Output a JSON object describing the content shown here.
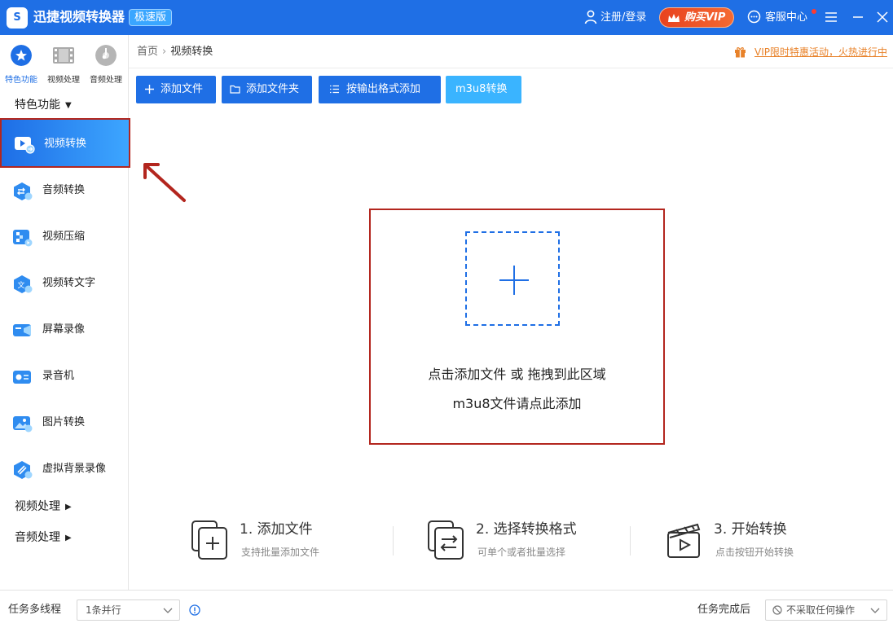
{
  "titlebar": {
    "logo_text": "S",
    "app_title": "迅捷视频转换器",
    "edition_badge": "极速版",
    "login_label": "注册/登录",
    "vip_label": "购买VIP",
    "service_label": "客服中心"
  },
  "sidebar": {
    "top_tabs": [
      {
        "label": "特色功能",
        "icon": "star-icon",
        "active": true
      },
      {
        "label": "视频处理",
        "icon": "film-icon",
        "active": false
      },
      {
        "label": "音频处理",
        "icon": "music-disc-icon",
        "active": false
      }
    ],
    "section_featured": "特色功能",
    "items": [
      {
        "label": "视频转换",
        "icon": "video-convert-icon",
        "active": true
      },
      {
        "label": "音频转换",
        "icon": "audio-convert-icon"
      },
      {
        "label": "视频压缩",
        "icon": "video-compress-icon"
      },
      {
        "label": "视频转文字",
        "icon": "video-to-text-icon"
      },
      {
        "label": "屏幕录像",
        "icon": "screen-record-icon"
      },
      {
        "label": "录音机",
        "icon": "recorder-icon"
      },
      {
        "label": "图片转换",
        "icon": "image-convert-icon"
      },
      {
        "label": "虚拟背景录像",
        "icon": "virtual-background-icon"
      }
    ],
    "section_video": "视频处理",
    "section_audio": "音频处理"
  },
  "breadcrumb": {
    "home": "首页",
    "separator": "›",
    "current": "视频转换"
  },
  "promo_text": "VIP限时特惠活动，火热进行中",
  "toolbar": {
    "add_file": "添加文件",
    "add_folder": "添加文件夹",
    "add_by_format": "按输出格式添加",
    "m3u8": "m3u8转换"
  },
  "drop_zone": {
    "line1": "点击添加文件 或 拖拽到此区域",
    "line2": "m3u8文件请点此添加"
  },
  "steps": [
    {
      "title": "1. 添加文件",
      "desc": "支持批量添加文件"
    },
    {
      "title": "2. 选择转换格式",
      "desc": "可单个或者批量选择"
    },
    {
      "title": "3. 开始转换",
      "desc": "点击按钮开始转换"
    }
  ],
  "statusbar": {
    "threads_label": "任务多线程",
    "threads_value": "1条并行",
    "after_label": "任务完成后",
    "after_value": "不采取任何操作"
  },
  "colors": {
    "primary": "#1f6fe5",
    "accent_light": "#3ab4ff",
    "highlight_red": "#b3261e",
    "promo": "#e8822a"
  }
}
